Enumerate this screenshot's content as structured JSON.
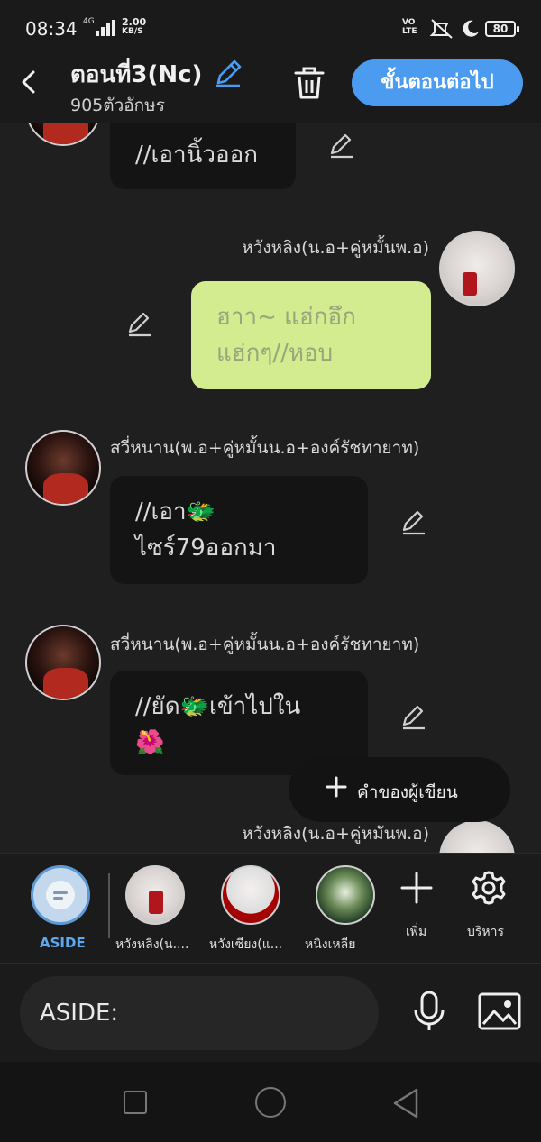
{
  "status_bar": {
    "time": "08:34",
    "network": "4G",
    "speed_value": "2.00",
    "speed_unit": "KB/S",
    "volte": "VO\nLTE",
    "battery": "80"
  },
  "header": {
    "title": "ตอนที่3(Nc)",
    "subtitle": "905ตัวอักษร",
    "next_label": "ขั้นตอนต่อไป"
  },
  "messages": [
    {
      "side": "left",
      "name": "",
      "text": "//เอานิ้วออก"
    },
    {
      "side": "right",
      "name": "หวังหลิง(น.อ+คู่หมั้นพ.อ)",
      "text": "ฮาา~ แฮ่กอึก\nแฮ่กๆ//หอบ"
    },
    {
      "side": "left",
      "name": "สวี่หนาน(พ.อ+คู่หมั้นน.อ+องค์รัชทายาท)",
      "text": "//เอา🐲\nไซร์79ออกมา"
    },
    {
      "side": "left",
      "name": "สวี่หนาน(พ.อ+คู่หมั้นน.อ+องค์รัชทายาท)",
      "text": "//ยัด🐲เข้าไปใน\n🌺"
    },
    {
      "side": "right",
      "name": "หวังหลิง(น.อ+คู่หมันพ.อ)",
      "text": ""
    }
  ],
  "fab": {
    "label": "คำของผู้เขียน"
  },
  "characters": {
    "aside_label": "ASIDE",
    "items": [
      {
        "label": "หวังหลิง(น...."
      },
      {
        "label": "หวังเซียง(แ..."
      },
      {
        "label": "หนิงเหลีย"
      }
    ],
    "add_label": "เพิ่ม",
    "manage_label": "บริหาร"
  },
  "input": {
    "value": "ASIDE:"
  }
}
